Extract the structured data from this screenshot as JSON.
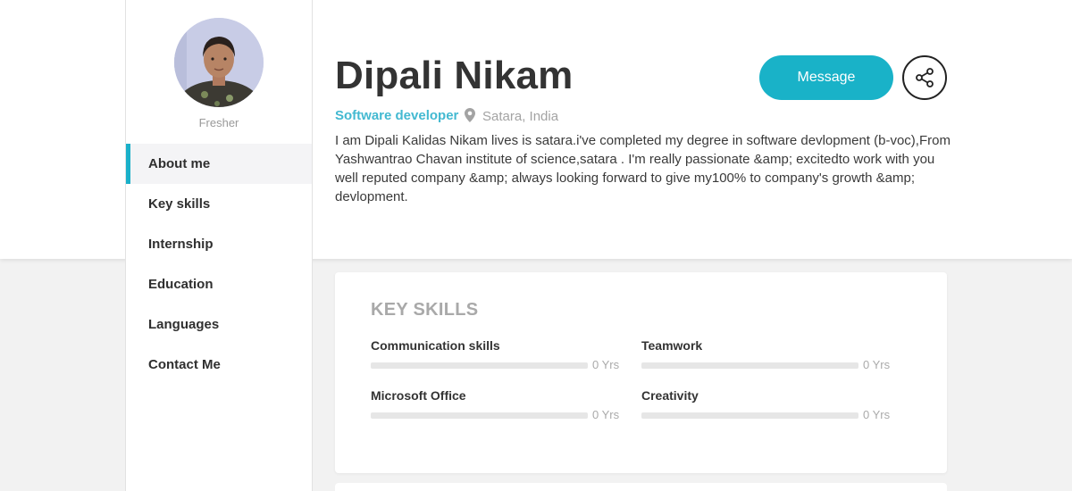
{
  "profile": {
    "name": "Dipali Nikam",
    "level": "Fresher",
    "role": "Software developer",
    "location": "Satara, India",
    "about": "I am Dipali Kalidas Nikam lives is satara.i've completed my degree in software devlopment (b-voc),From Yashwantrao Chavan institute of science,satara . I'm really passionate &amp; excitedto work with you well reputed company &amp; always looking forward to give my100% to company's growth &amp; devlopment."
  },
  "actions": {
    "message_label": "Message"
  },
  "sidebar": {
    "items": [
      {
        "label": "About me",
        "active": true
      },
      {
        "label": "Key skills",
        "active": false
      },
      {
        "label": "Internship",
        "active": false
      },
      {
        "label": "Education",
        "active": false
      },
      {
        "label": "Languages",
        "active": false
      },
      {
        "label": "Contact Me",
        "active": false
      }
    ]
  },
  "key_skills": {
    "title": "KEY SKILLS",
    "skills": [
      {
        "name": "Communication skills",
        "years_label": "0 Yrs",
        "level": 0
      },
      {
        "name": "Teamwork",
        "years_label": "0 Yrs",
        "level": 0
      },
      {
        "name": "Microsoft Office",
        "years_label": "0 Yrs",
        "level": 0
      },
      {
        "name": "Creativity",
        "years_label": "0 Yrs",
        "level": 0
      }
    ]
  },
  "colors": {
    "accent": "#19b2c8",
    "role_text": "#43b9d1",
    "background": "#f2f2f2"
  },
  "icons": {
    "location": "map-pin-icon",
    "share": "share-icon"
  }
}
